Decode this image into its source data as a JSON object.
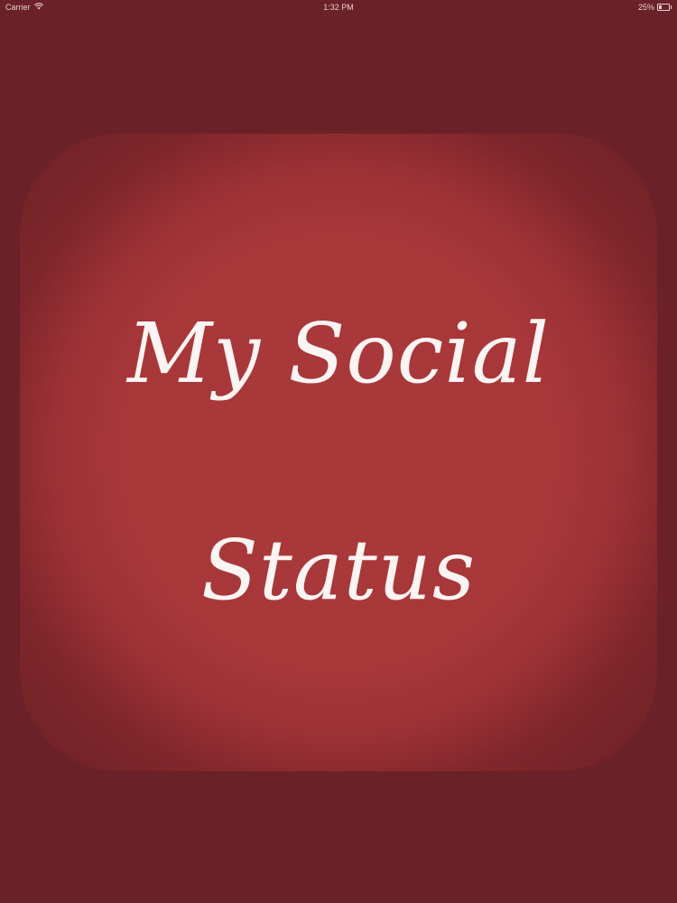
{
  "status_bar": {
    "carrier": "Carrier",
    "time": "1:32 PM",
    "battery": "25%",
    "battery_level": 0.25,
    "wifi_icon": "wifi-icon",
    "battery_icon": "battery-icon"
  },
  "splash": {
    "title_line1": "My Social",
    "title_line2": "Status",
    "background_color": "#6b2128",
    "card_color": "#a9383b",
    "text_color": "#fbf4f2"
  }
}
